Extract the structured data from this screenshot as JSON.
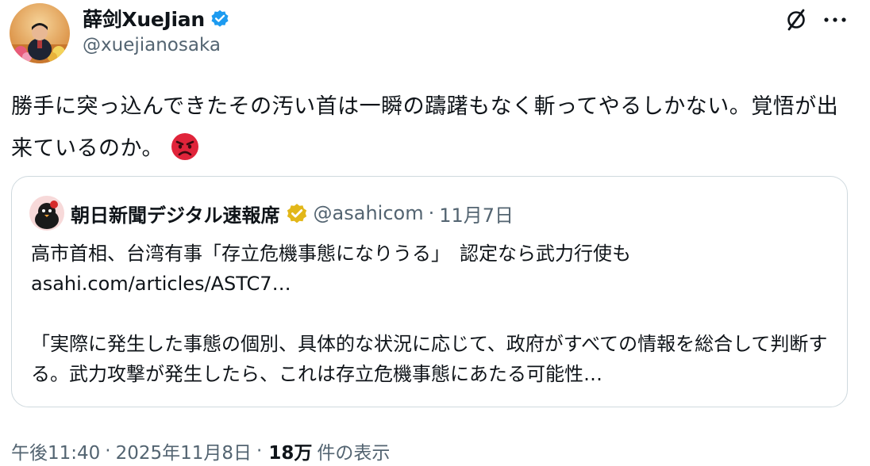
{
  "author": {
    "display_name": "薛剑XueJian",
    "handle": "@xuejianosaka",
    "verified": true,
    "verified_color": "#1d9bf0",
    "avatar": "profile-photo"
  },
  "header_actions": {
    "grok_icon": "grok-icon",
    "more_icon": "more-icon",
    "more_label": "···"
  },
  "tweet": {
    "text": "勝手に突っ込んできたその汚い首は一瞬の躊躇もなく斬ってやるしかない。覚悟が出来ているのか。",
    "emoji": "angry-face-emoji"
  },
  "quoted_tweet": {
    "display_name": "朝日新聞デジタル速報席",
    "handle": "@asahicom",
    "separator": "·",
    "date": "11月7日",
    "badge": "gold-verified-badge",
    "badge_color": "#e2b719",
    "line1": "高市首相、台湾有事「存立危機事態になりうる」　認定なら武力行使も",
    "link": "asahi.com/articles/ASTC7…",
    "quote_text": "「実際に発生した事態の個別、具体的な状況に応じて、政府がすべての情報を総合して判断する。武力攻撃が発生したら、これは存立危機事態にあたる可能性…"
  },
  "meta": {
    "time": "午後11:40",
    "sep1": "·",
    "date": "2025年11月8日",
    "sep2": "·",
    "views_count": "18万",
    "views_label": "件の表示"
  }
}
